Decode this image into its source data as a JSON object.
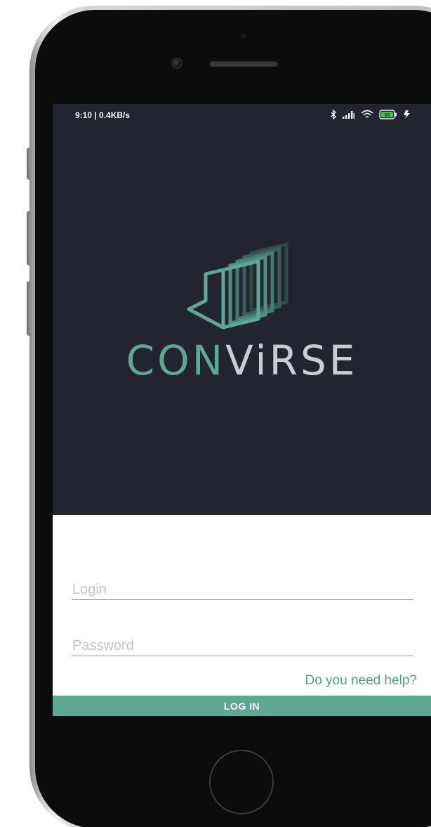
{
  "status_bar": {
    "time_and_speed": "9:10 | 0.4KB/s",
    "battery_level": "65",
    "icons": [
      "bluetooth-icon",
      "signal-icon",
      "wifi-icon",
      "battery-icon",
      "charging-icon"
    ]
  },
  "brand": {
    "part_a": "CON",
    "part_b": "ViRSE",
    "colors": {
      "accent": "#5ea792",
      "light": "#c9ccd3",
      "background": "#222530"
    }
  },
  "form": {
    "login": {
      "value": "",
      "placeholder": "Login"
    },
    "password": {
      "value": "",
      "placeholder": "Password"
    },
    "help_link": "Do you need help?",
    "login_button": "LOG IN"
  }
}
